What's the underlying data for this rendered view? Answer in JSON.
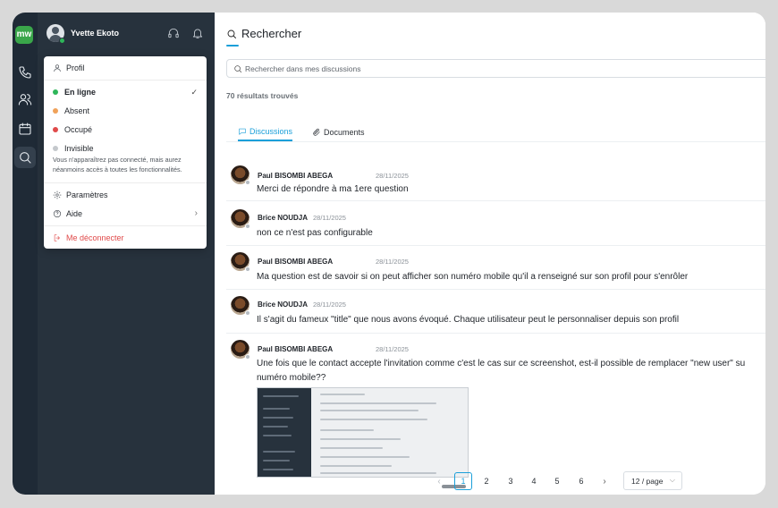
{
  "app": {
    "logo_text": "mw",
    "brand_color": "#3aa64a",
    "accent_color": "#1a9fd9"
  },
  "rail": {
    "items": [
      {
        "icon": "phone-icon"
      },
      {
        "icon": "contacts-icon"
      },
      {
        "icon": "calendar-icon"
      },
      {
        "icon": "search-icon",
        "active": true
      }
    ]
  },
  "user": {
    "name": "Yvette Ekoto",
    "status_color": "#2eb65a"
  },
  "status_menu": {
    "profile_label": "Profil",
    "statuses": [
      {
        "label": "En ligne",
        "color": "#2eb65a",
        "selected": true
      },
      {
        "label": "Absent",
        "color": "#f0a25a"
      },
      {
        "label": "Occupé",
        "color": "#e04a4a"
      },
      {
        "label": "Invisible",
        "color": "#c4c8cc"
      }
    ],
    "invisible_note": "Vous n'apparaîtrez pas connecté, mais aurez néanmoins accès à toutes les fonctionnalités.",
    "settings_label": "Paramètres",
    "help_label": "Aide",
    "logout_label": "Me déconnecter"
  },
  "main": {
    "title": "Rechercher",
    "search_placeholder": "Rechercher dans mes discussions",
    "results_count": "70 résultats trouvés",
    "tabs": [
      {
        "label": "Discussions",
        "active": true
      },
      {
        "label": "Documents"
      }
    ],
    "messages": [
      {
        "author": "Paul BISOMBI ABEGA",
        "date": "28/11/2025",
        "text": "Merci de répondre à ma 1ere question"
      },
      {
        "author": "Brice NOUDJA",
        "date": "28/11/2025",
        "text": "non ce n'est pas configurable"
      },
      {
        "author": "Paul BISOMBI ABEGA",
        "date": "28/11/2025",
        "text": "Ma question est de savoir si on peut afficher son numéro mobile qu'il a renseigné sur son profil pour s'enrôler"
      },
      {
        "author": "Brice NOUDJA",
        "date": "28/11/2025",
        "text": "Il s'agit du fameux \"title\" que nous avons évoqué. Chaque utilisateur peut le personnaliser depuis son profil"
      },
      {
        "author": "Paul BISOMBI ABEGA",
        "date": "28/11/2025",
        "text_line1": "Une fois que le contact accepte l'invitation comme c'est le cas sur ce screenshot, est-il possible de remplacer \"new user\" su",
        "text_line2": "numéro mobile??",
        "has_attachment": true
      }
    ]
  },
  "pagination": {
    "prev": "‹",
    "next": "›",
    "pages": [
      "1",
      "2",
      "3",
      "4",
      "5",
      "6"
    ],
    "current_page": "1",
    "per_page": "12 / page"
  }
}
